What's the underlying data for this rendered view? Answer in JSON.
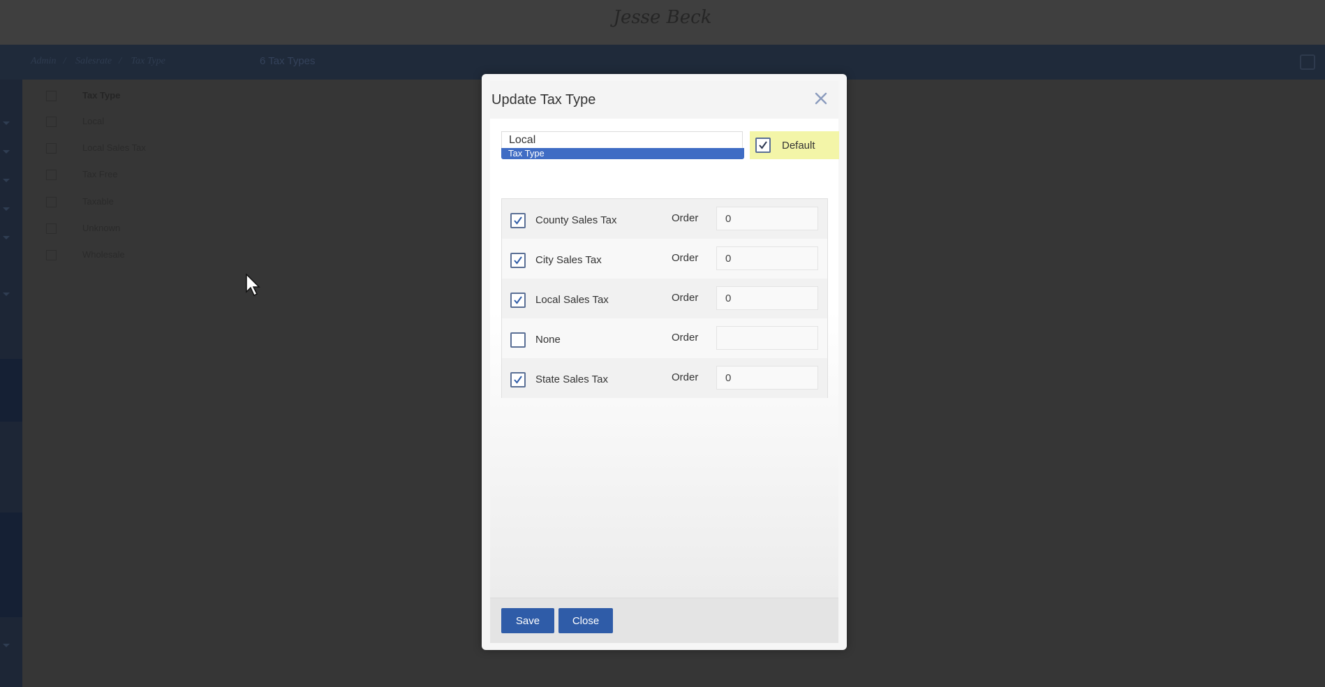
{
  "app": {
    "brand": "Jesse Beck",
    "breadcrumb": [
      "Admin",
      "Salesrate",
      "Tax Type"
    ],
    "list_title": "6 Tax Types"
  },
  "background_list": {
    "header": "Tax Type",
    "rows": [
      "Local",
      "Local Sales Tax",
      "Tax Free",
      "Taxable",
      "Unknown",
      "Wholesale"
    ]
  },
  "modal": {
    "title": "Update Tax Type",
    "tax_type_value": "Local",
    "tax_type_label": "Tax Type",
    "default_label": "Default",
    "default_checked": true,
    "order_label": "Order",
    "taxes": [
      {
        "name": "County Sales Tax",
        "checked": true,
        "order": "0"
      },
      {
        "name": "City Sales Tax",
        "checked": true,
        "order": "0"
      },
      {
        "name": "Local Sales Tax",
        "checked": true,
        "order": "0"
      },
      {
        "name": "None",
        "checked": false,
        "order": ""
      },
      {
        "name": "State Sales Tax",
        "checked": true,
        "order": "0"
      }
    ],
    "save_label": "Save",
    "close_label": "Close"
  },
  "icons": {
    "close": "close-icon",
    "check": "check-icon",
    "cursor": "mouse-cursor-icon",
    "refresh": "refresh-icon"
  },
  "colors": {
    "accent": "#2f5ca8",
    "label_bar": "#3f6cc4",
    "default_highlight": "#f3f5a8"
  }
}
